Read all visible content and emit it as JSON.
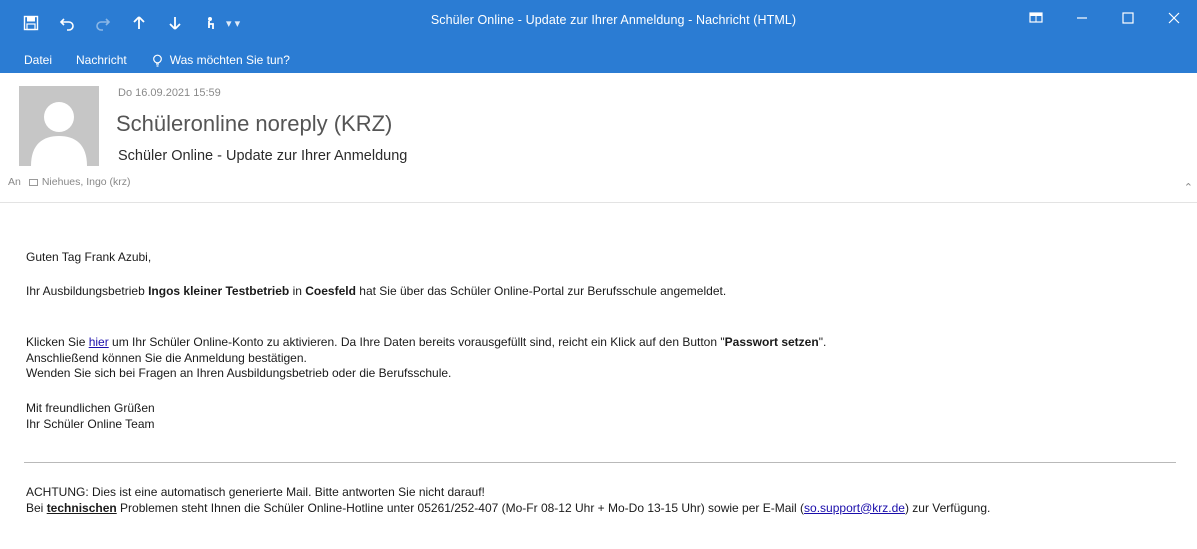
{
  "window": {
    "title": "Schüler Online - Update zur Ihrer Anmeldung  -  Nachricht (HTML)",
    "accent_color": "#2b7cd3"
  },
  "quick_access": {
    "icons": [
      "save-icon",
      "undo-icon",
      "redo-icon",
      "previous-item-icon",
      "next-item-icon",
      "touch-mode-icon",
      "customize-qat-icon"
    ]
  },
  "ribbon": {
    "tabs": [
      "Datei",
      "Nachricht"
    ],
    "tell_me": "Was möchten Sie tun?"
  },
  "message": {
    "date": "Do 16.09.2021 15:59",
    "sender": "Schüleronline noreply (KRZ)",
    "subject": "Schüler Online - Update zur Ihrer Anmeldung",
    "to_label": "An",
    "to_recipient": "Niehues, Ingo (krz)"
  },
  "body": {
    "greeting": "Guten Tag Frank Azubi,",
    "intro_pre": "Ihr Ausbildungsbetrieb ",
    "intro_company": "Ingos kleiner Testbetrieb",
    "intro_mid": " in ",
    "intro_city": "Coesfeld",
    "intro_post": " hat Sie über das Schüler Online-Portal zur Berufsschule angemeldet.",
    "p1_pre": "Klicken Sie ",
    "p1_link": "hier",
    "p1_mid": " um Ihr Schüler Online-Konto zu aktivieren. Da Ihre Daten bereits vorausgefüllt sind, reicht ein Klick auf den Button \"",
    "p1_button": "Passwort setzen",
    "p1_post": "\".",
    "p1_line2": "Anschließend können Sie die Anmeldung bestätigen.",
    "p1_line3": "Wenden Sie sich bei Fragen an Ihren Ausbildungsbetrieb oder die Berufsschule.",
    "closing_line1": "Mit freundlichen Grüßen",
    "closing_line2": "Ihr Schüler Online Team",
    "notice_line1": "ACHTUNG: Dies ist eine automatisch generierte Mail. Bitte antworten Sie nicht darauf!",
    "notice_pre": "Bei ",
    "notice_tech": "technischen",
    "notice_mid": " Problemen steht Ihnen die Schüler Online-Hotline unter 05261/252-407 (Mo-Fr 08-12 Uhr + Mo-Do 13-15 Uhr) sowie per E-Mail (",
    "notice_email": "so.support@krz.de",
    "notice_post": ") zur Verfügung."
  }
}
